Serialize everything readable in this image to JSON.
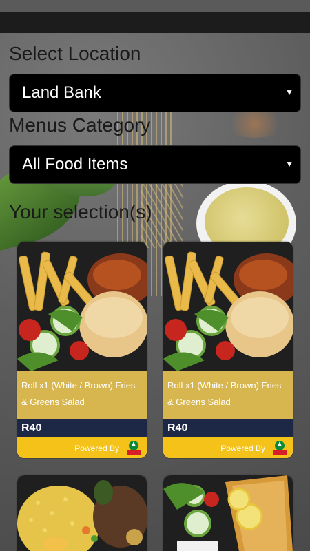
{
  "location": {
    "label": "Select Location",
    "selected": "Land Bank"
  },
  "category": {
    "label": "Menus Category",
    "selected": "All Food Items"
  },
  "selection_heading": "Your selection(s)",
  "cards": [
    {
      "description": "Roll x1 (White / Brown) Fries & Greens Salad",
      "price": "R40",
      "powered_by": "Powered By",
      "brand": "SPAR"
    },
    {
      "description": "Roll x1 (White / Brown) Fries & Greens Salad",
      "price": "R40",
      "powered_by": "Powered By",
      "brand": "SPAR"
    }
  ],
  "colors": {
    "card_desc_bg": "#d7b64f",
    "price_bar": "#1d2746",
    "powered_bar": "#f5c21a",
    "select_bg": "#000000"
  },
  "icons": [
    "dropdown-arrow-icon",
    "spar-logo-icon"
  ]
}
